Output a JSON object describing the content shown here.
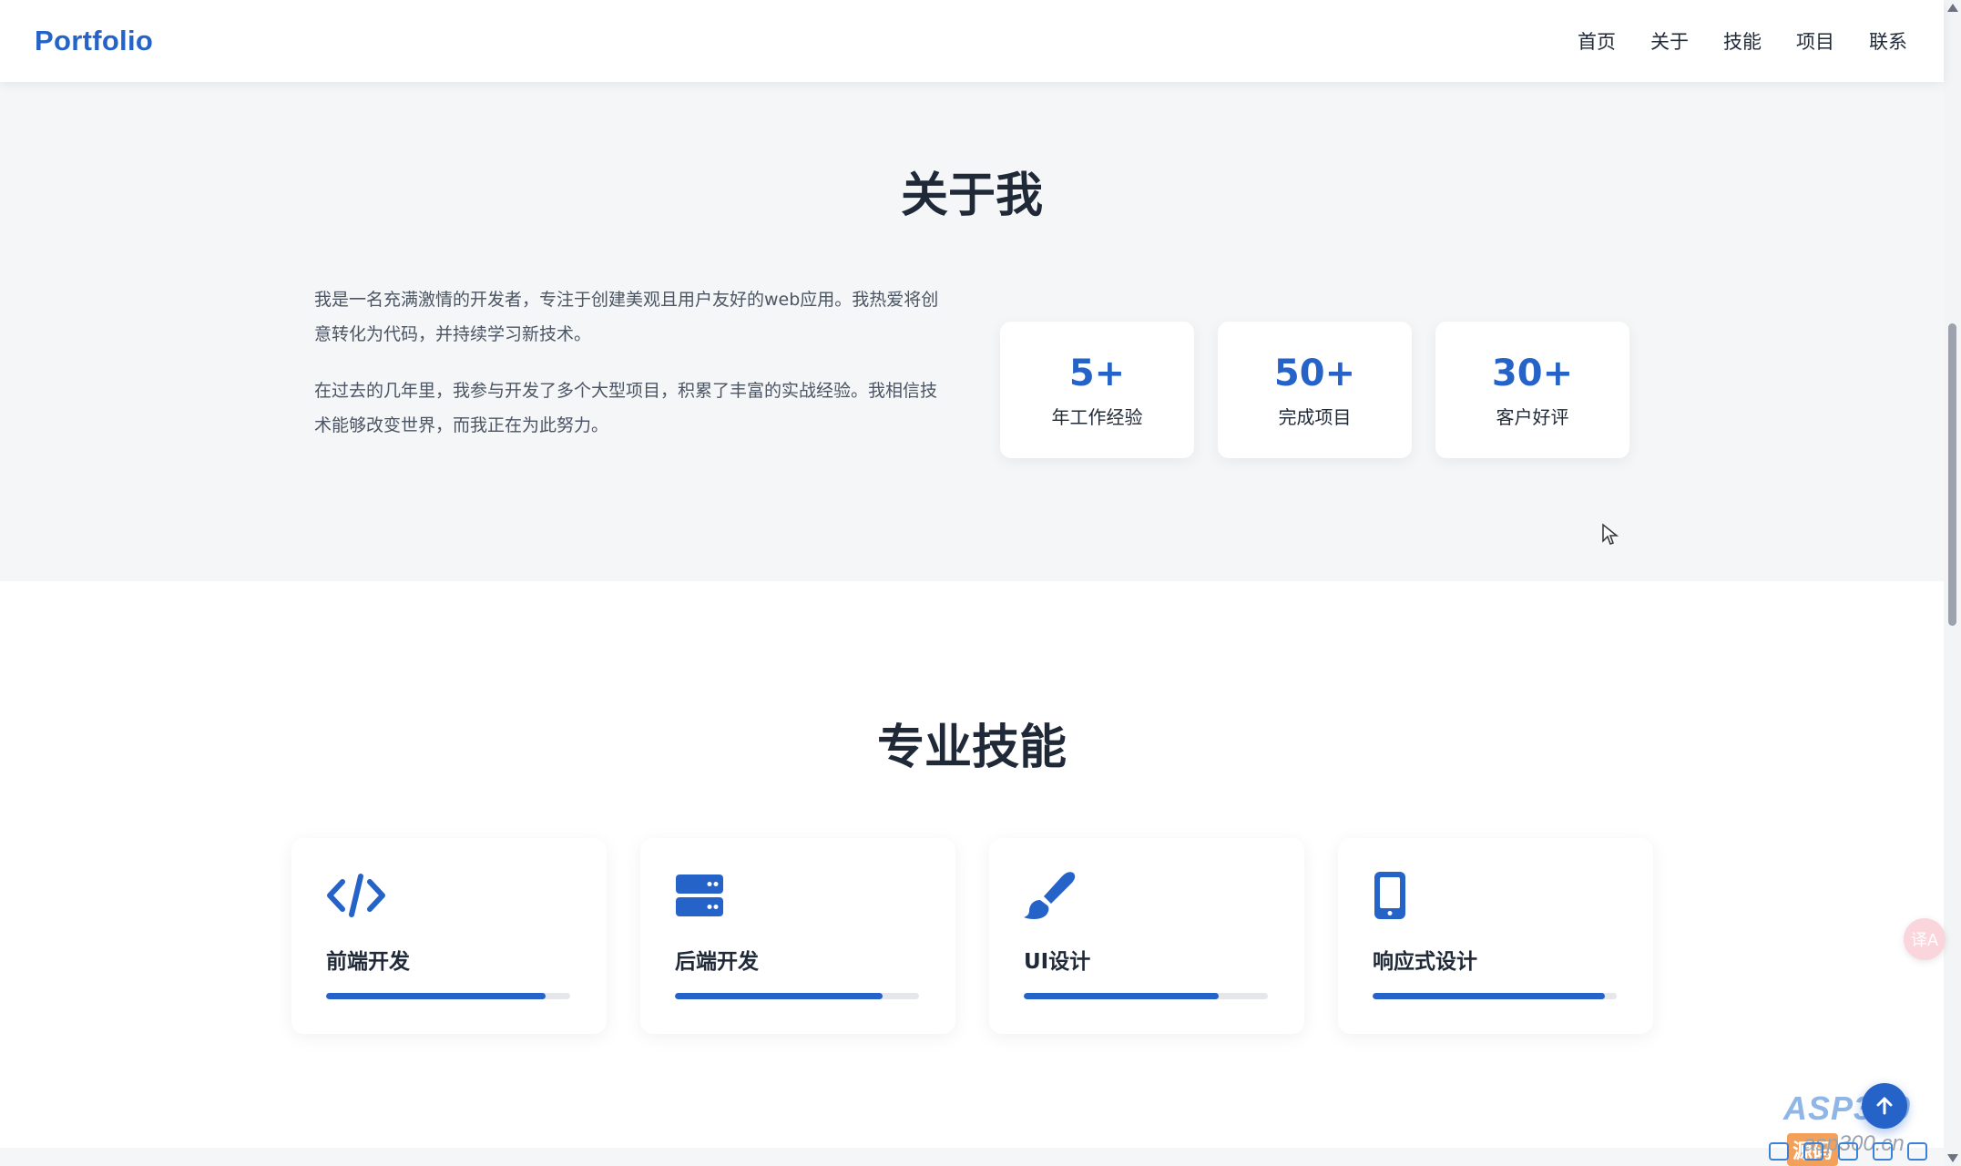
{
  "header": {
    "logo": "Portfolio",
    "nav": [
      "首页",
      "关于",
      "技能",
      "项目",
      "联系"
    ]
  },
  "about": {
    "title": "关于我",
    "paragraphs": [
      "我是一名充满激情的开发者，专注于创建美观且用户友好的web应用。我热爱将创意转化为代码，并持续学习新技术。",
      "在过去的几年里，我参与开发了多个大型项目，积累了丰富的实战经验。我相信技术能够改变世界，而我正在为此努力。"
    ],
    "stats": [
      {
        "number": "5+",
        "label": "年工作经验"
      },
      {
        "number": "50+",
        "label": "完成项目"
      },
      {
        "number": "30+",
        "label": "客户好评"
      }
    ]
  },
  "skills": {
    "title": "专业技能",
    "items": [
      {
        "name": "前端开发",
        "icon": "code-icon",
        "level": 0.9
      },
      {
        "name": "后端开发",
        "icon": "server-icon",
        "level": 0.85
      },
      {
        "name": "UI设计",
        "icon": "paint-brush-icon",
        "level": 0.8
      },
      {
        "name": "响应式设计",
        "icon": "mobile-icon",
        "level": 0.95
      }
    ]
  },
  "widgets": {
    "translate_label": "译A",
    "watermark": "ASP300",
    "watermark_tag": "源码",
    "watermark_domain": "asp300.cn"
  },
  "colors": {
    "accent": "#2563c9",
    "section_bg": "#f4f6f8",
    "text_dark": "#1f2937"
  }
}
